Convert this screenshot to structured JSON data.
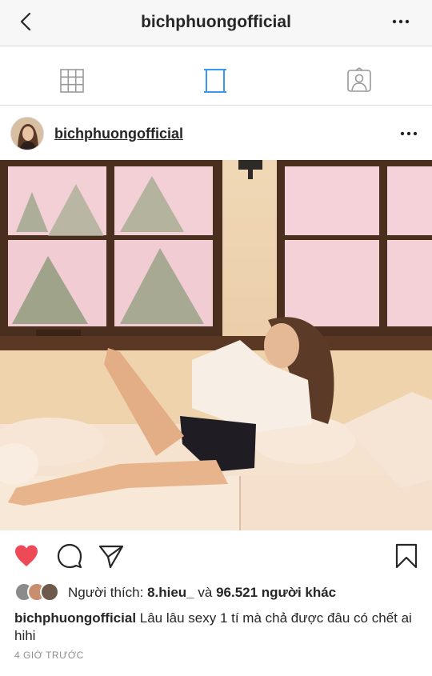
{
  "header": {
    "title": "bichphuongofficial",
    "back_icon": "chevron-left-icon",
    "more_icon": "more-horizontal-icon"
  },
  "tabs": [
    {
      "name": "grid",
      "icon": "grid-icon"
    },
    {
      "name": "feed",
      "icon": "feed-icon",
      "active": true
    },
    {
      "name": "tagged",
      "icon": "tagged-person-icon"
    }
  ],
  "post": {
    "username": "bichphuongofficial",
    "photo_description": "photo",
    "actions": {
      "like_icon": "heart-icon",
      "liked": true,
      "comment_icon": "comment-icon",
      "share_icon": "send-icon",
      "save_icon": "bookmark-icon"
    },
    "likes": {
      "prefix": "Người thích: ",
      "first_user": "8.hieu_",
      "connector": " và ",
      "count_text": "96.521 người khác"
    },
    "caption": {
      "username": "bichphuongofficial",
      "text": " Lâu lâu sexy 1 tí mà chả được đâu có chết ai hihi"
    },
    "timestamp": "4 GIỜ TRƯỚC"
  },
  "colors": {
    "like_red": "#ed4956",
    "active_tab_blue": "#3897f0",
    "icon_gray": "#999999",
    "text": "#262626",
    "muted": "#8e8e8e"
  }
}
